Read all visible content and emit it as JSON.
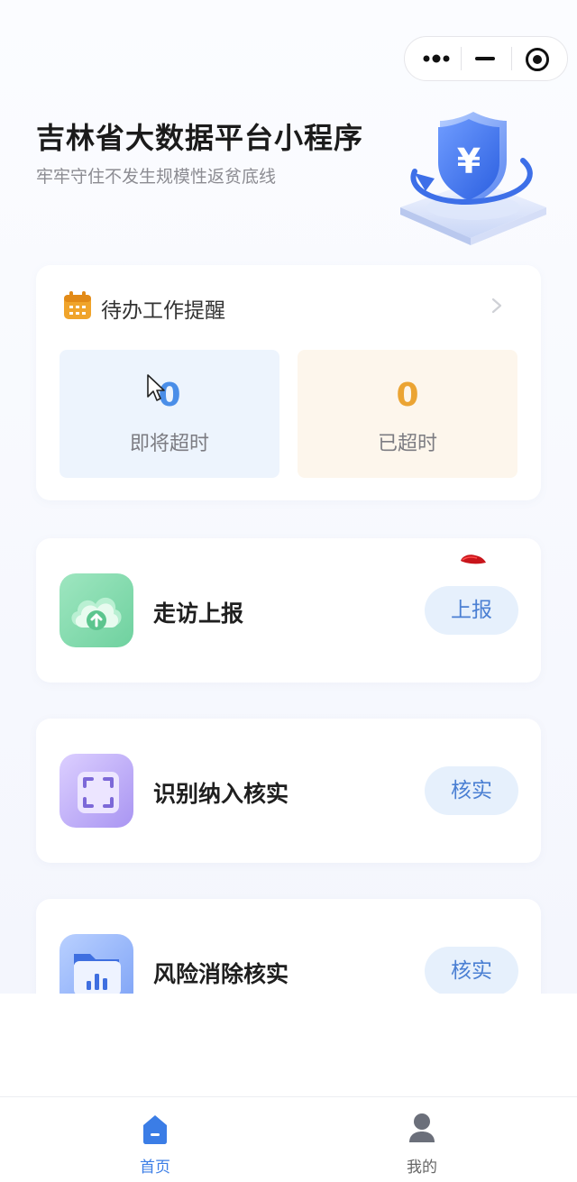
{
  "header": {
    "title": "吉林省大数据平台小程序",
    "subtitle": "牢牢守住不发生规模性返贫底线"
  },
  "todo": {
    "title": "待办工作提醒",
    "soon": {
      "value": "0",
      "label": "即将超时"
    },
    "overdue": {
      "value": "0",
      "label": "已超时"
    }
  },
  "actions": [
    {
      "label": "走访上报",
      "button": "上报",
      "icon": "cloud-upload-icon"
    },
    {
      "label": "识别纳入核实",
      "button": "核实",
      "icon": "scan-frame-icon"
    },
    {
      "label": "风险消除核实",
      "button": "核实",
      "icon": "folder-chart-icon"
    }
  ],
  "tabbar": {
    "home": "首页",
    "mine": "我的"
  },
  "colors": {
    "accent": "#3b7de6",
    "soon_number": "#4a8ee8",
    "overdue_number": "#eba433",
    "button_bg": "#e6f0fc"
  }
}
